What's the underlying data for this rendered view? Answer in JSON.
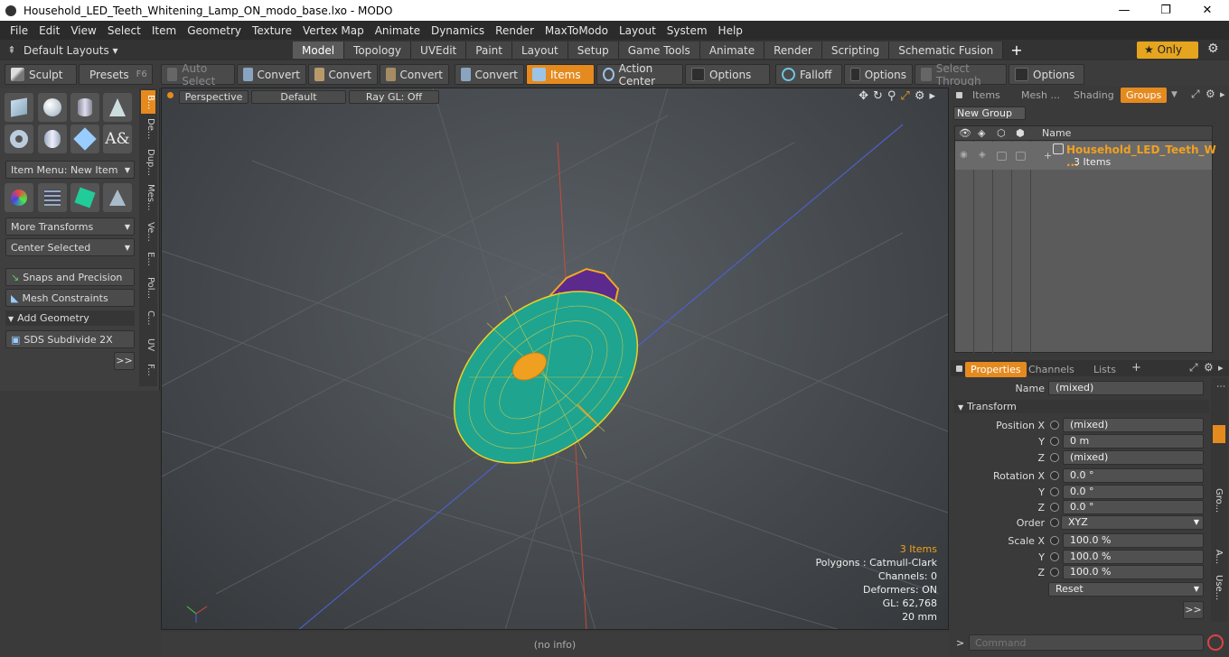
{
  "window": {
    "title": "Household_LED_Teeth_Whitening_Lamp_ON_modo_base.lxo - MODO",
    "minimize": "—",
    "maximize": "❐",
    "close": "✕"
  },
  "menu": [
    "File",
    "Edit",
    "View",
    "Select",
    "Item",
    "Geometry",
    "Texture",
    "Vertex Map",
    "Animate",
    "Dynamics",
    "Render",
    "MaxToModo",
    "Layout",
    "System",
    "Help"
  ],
  "layouts": {
    "label": "Default Layouts ▾",
    "tabs": [
      "Model",
      "Topology",
      "UVEdit",
      "Paint",
      "Layout",
      "Setup",
      "Game Tools",
      "Animate",
      "Render",
      "Scripting",
      "Schematic Fusion"
    ],
    "add": "+",
    "only": "★  Only"
  },
  "toolbar": {
    "sculpt": "Sculpt",
    "presets": "Presets",
    "presets_key": "F6",
    "auto_select": "Auto Select",
    "convert": "Convert",
    "items": "Items",
    "action_center": "Action Center",
    "options": "Options",
    "falloff": "Falloff",
    "select_through": "Select Through"
  },
  "leftpanel": {
    "item_menu": "Item Menu: New Item",
    "more_transforms": "More Transforms",
    "center_selected": "Center Selected",
    "snaps": "Snaps and Precision",
    "mesh_constraints": "Mesh Constraints",
    "add_geometry": "Add Geometry",
    "sds": "SDS Subdivide 2X",
    "more": ">>"
  },
  "vtabs": [
    "B...",
    "De...",
    "Dup...",
    "Mes...",
    "Ve...",
    "E...",
    "Pol...",
    "C...",
    "UV",
    "F..."
  ],
  "viewport": {
    "perspective": "Perspective",
    "default": "Default",
    "raygl": "Ray GL: Off",
    "info": {
      "items": "3 Items",
      "polygons": "Polygons : Catmull-Clark",
      "channels": "Channels: 0",
      "deformers": "Deformers: ON",
      "gl": "GL: 62,768",
      "unit": "20 mm"
    }
  },
  "status": "(no info)",
  "groups": {
    "tabs": [
      "Items",
      "Mesh ...",
      "Shading",
      "Groups"
    ],
    "new_group": "New Group",
    "name_col": "Name",
    "group_name": "Household_LED_Teeth_W ...",
    "group_count": "3 Items"
  },
  "properties": {
    "tabs": [
      "Properties",
      "Channels",
      "Lists"
    ],
    "add": "+",
    "name_label": "Name",
    "name_value": "(mixed)",
    "transform": "Transform",
    "position": [
      {
        "label": "Position X",
        "value": "(mixed)"
      },
      {
        "label": "Y",
        "value": "0 m"
      },
      {
        "label": "Z",
        "value": "(mixed)"
      }
    ],
    "rotation": [
      {
        "label": "Rotation X",
        "value": "0.0 °"
      },
      {
        "label": "Y",
        "value": "0.0 °"
      },
      {
        "label": "Z",
        "value": "0.0 °"
      }
    ],
    "order_label": "Order",
    "order_value": "XYZ",
    "scale": [
      {
        "label": "Scale X",
        "value": "100.0 %"
      },
      {
        "label": "Y",
        "value": "100.0 %"
      },
      {
        "label": "Z",
        "value": "100.0 %"
      }
    ],
    "reset": "Reset",
    "more": ">>",
    "side_tabs": [
      "Gro...",
      "A...",
      "Use..."
    ]
  },
  "command": {
    "placeholder": "Command",
    "prompt": ">"
  }
}
